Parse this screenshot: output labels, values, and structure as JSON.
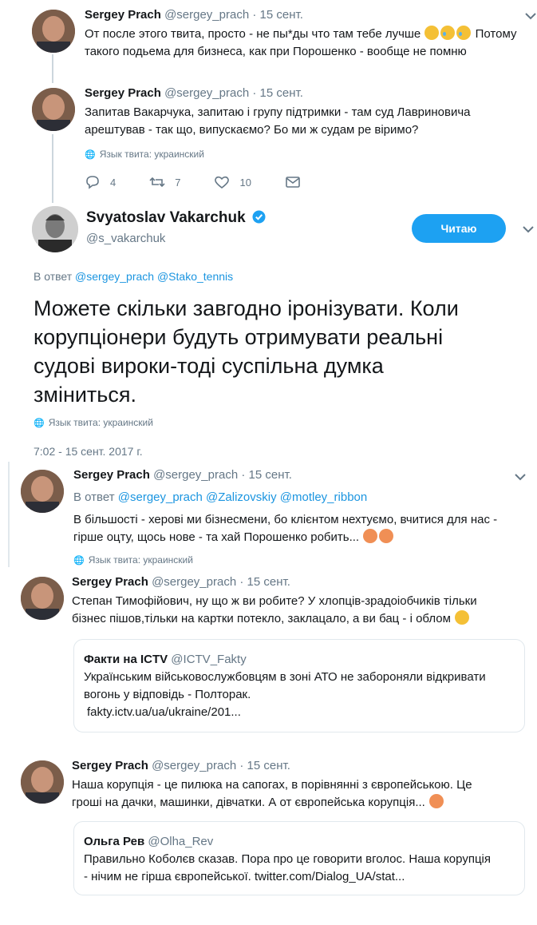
{
  "tweet1": {
    "name": "Sergey Prach",
    "handle": "@sergey_prach",
    "dot": "·",
    "date": "15 сент.",
    "line1": "От после этого твита, просто - не пы*ды что там тебе лучше",
    "line1_tail": "Потому",
    "line2": "такого подьема для бизнеса, как при Порошенко - вообще не помню"
  },
  "tweet2": {
    "name": "Sergey Prach",
    "handle": "@sergey_prach",
    "dot": "·",
    "date": "15 сент.",
    "line1": "Запитав Вакарчука, запитаю і групу підтримки - там суд Лавриновича",
    "line2": "арештував - так що, випускаємо? Бо ми ж судам ре віримо?",
    "lang": "Язык твита: украинский",
    "reply_count": "4",
    "retweet_count": "7",
    "like_count": "10"
  },
  "main": {
    "name": "Svyatoslav Vakarchuk",
    "handle": "@s_vakarchuk",
    "follow_label": "Читаю",
    "reply_prefix": "В ответ",
    "reply_user1": "@sergey_prach",
    "reply_user2": "@Stako_tennis",
    "text_line1": "Можете скільки завгодно іронізувати. Коли",
    "text_line2": "корупціонери будуть отримувати реальні",
    "text_line3": "судові вироки-тоді суспільна думка",
    "text_line4": "зміниться.",
    "lang": "Язык твита: украинский",
    "timestamp": "7:02 - 15 сент. 2017 г."
  },
  "reply1": {
    "name": "Sergey Prach",
    "handle": "@sergey_prach",
    "dot": "·",
    "date": "15 сент.",
    "reply_prefix": "В ответ",
    "reply_users": "@sergey_prach @Zalizovskiy @motley_ribbon",
    "line1": "В більшості - херові ми бізнесмени, бо клієнтом нехтуємо, вчитися для нас -",
    "line2": "гірше оцту, щось нове - та хай Порошенко робить...",
    "lang": "Язык твита: украинский"
  },
  "reply2": {
    "name": "Sergey Prach",
    "handle": "@sergey_prach",
    "dot": "·",
    "date": "15 сент.",
    "line1": "Степан Тимофійович, ну що ж ви робите? У хлопців-зрадоіобчиків тільки",
    "line2": "бізнес пішов,тільки на картки потекло, заклацало, а ви бац - і облом",
    "quote": {
      "name": "Факти на ICTV",
      "handle": "@ICTV_Fakty",
      "line1": "Українським військовослужбовцям в зоні АТО не забороняли відкривати",
      "line2": "вогонь у відповідь - Полторак.",
      "line3": "fakty.ictv.ua/ua/ukraine/201..."
    }
  },
  "reply3": {
    "name": "Sergey Prach",
    "handle": "@sergey_prach",
    "dot": "·",
    "date": "15 сент.",
    "line1": "Наша корупція - це пилюка на сапогах, в порівнянні з європейською. Це",
    "line2": "гроші на дачки, машинки, дівчатки. А от європейська корупція...",
    "quote": {
      "name": "Ольга Рев",
      "handle": "@Olha_Rev",
      "line1": "Правильно Коболєв сказав. Пора про це говорити вголос. Наша корупція",
      "line2": "- нічим не гірша європейської. twitter.com/Dialog_UA/stat..."
    }
  },
  "colors": {
    "accent": "#1da1f2",
    "link": "#1b95e0",
    "muted": "#657786",
    "verified": "#1da1f2"
  },
  "icons": [
    "chevron-down-icon",
    "globe-icon",
    "reply-icon",
    "retweet-icon",
    "like-icon",
    "message-icon",
    "verified-icon",
    "wink-emoji",
    "laughing-tears-emoji",
    "angry-emoji"
  ]
}
